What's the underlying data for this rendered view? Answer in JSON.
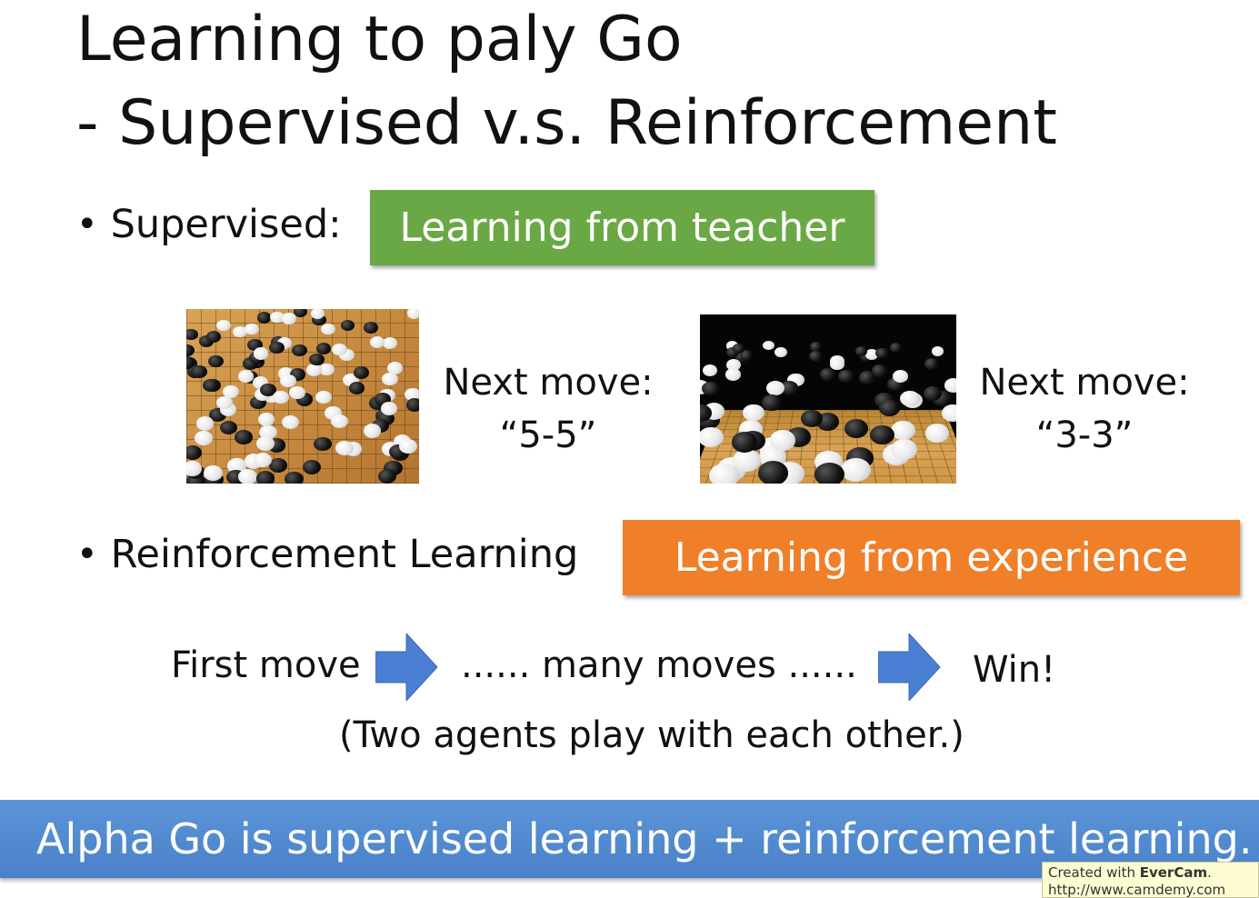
{
  "title": {
    "line1": "Learning to paly Go",
    "line2": "- Supervised v.s. Reinforcement"
  },
  "supervised": {
    "bullet": "Supervised:",
    "tag": "Learning from teacher",
    "tag_color": "#6aa845",
    "examples": [
      {
        "line1": "Next move:",
        "line2": "“5-5”"
      },
      {
        "line1": "Next move:",
        "line2": "“3-3”"
      }
    ]
  },
  "reinforcement": {
    "bullet": "Reinforcement Learning",
    "tag": "Learning from experience",
    "tag_color": "#f07f2a",
    "flow": {
      "first": "First move",
      "middle": "...... many moves ......",
      "end": "Win!",
      "arrow_icon": "right-arrow-icon",
      "arrow_color": "#4a7fd4",
      "note": "(Two agents play with each other.)"
    }
  },
  "banner": {
    "text": "Alpha Go is supervised learning + reinforcement learning.",
    "color": "#4a80c8"
  },
  "watermark": {
    "line1_prefix": "Created with ",
    "brand": "EverCam",
    "line1_suffix": ".",
    "line2": "http://www.camdemy.com"
  }
}
